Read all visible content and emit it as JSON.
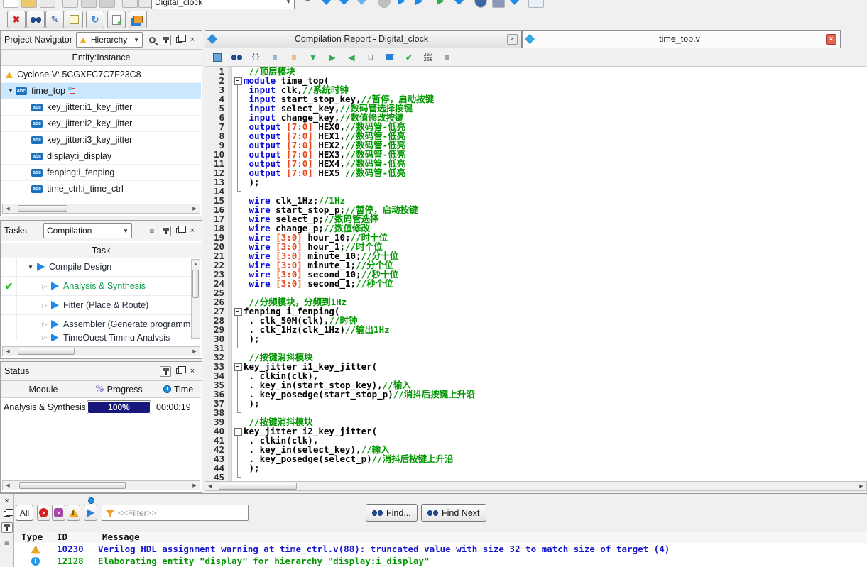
{
  "icons": {
    "close": "×",
    "menu": "≡",
    "down": "▼",
    "up": "▲",
    "left": "◀",
    "right": "▶",
    "expander_open": "▼",
    "expander_closed": "▷",
    "check": "✔",
    "refresh": "↻",
    "pencil": "✎",
    "cross": "✖",
    "abc_badge": "abc",
    "percent": "%",
    "error_glyph": "×",
    "info_glyph": "i",
    "brace": "{ }"
  },
  "colors": {
    "keyword": "#0b0bd8",
    "comment": "#009700",
    "number": "#e8481c",
    "selection": "#cbe8ff",
    "progress_bar": "#17177c",
    "warning_message": "#1515cc",
    "info_message": "#009700"
  },
  "titlebar": {
    "project_combo": "Digital_clock"
  },
  "project_navigator": {
    "title": "Project Navigator",
    "mode_combo": "Hierarchy",
    "column_header": "Entity:Instance",
    "tree": [
      {
        "label": "Cyclone V: 5CGXFC7C7F23C8",
        "icon": "device",
        "level": 0,
        "selected": false
      },
      {
        "label": "time_top",
        "icon": "abc",
        "level": 1,
        "selected": true,
        "badge": true
      },
      {
        "label": "key_jitter:i1_key_jitter",
        "icon": "abc",
        "level": 2,
        "selected": false
      },
      {
        "label": "key_jitter:i2_key_jitter",
        "icon": "abc",
        "level": 2,
        "selected": false
      },
      {
        "label": "key_jitter:i3_key_jitter",
        "icon": "abc",
        "level": 2,
        "selected": false
      },
      {
        "label": "display:i_display",
        "icon": "abc",
        "level": 2,
        "selected": false
      },
      {
        "label": "fenping:i_fenping",
        "icon": "abc",
        "level": 2,
        "selected": false
      },
      {
        "label": "time_ctrl:i_time_ctrl",
        "icon": "abc",
        "level": 2,
        "selected": false
      }
    ]
  },
  "tasks": {
    "title": "Tasks",
    "mode_combo": "Compilation",
    "column_header": "Task",
    "rows": [
      {
        "label": "Compile Design",
        "level": 0,
        "expander": "open",
        "check": false,
        "green": false,
        "clipped": false
      },
      {
        "label": "Analysis & Synthesis",
        "level": 1,
        "expander": "closed",
        "check": true,
        "green": true,
        "clipped": false
      },
      {
        "label": "Fitter (Place & Route)",
        "level": 1,
        "expander": "closed",
        "check": false,
        "green": false,
        "clipped": false
      },
      {
        "label": "Assembler (Generate programm",
        "level": 1,
        "expander": "closed",
        "check": false,
        "green": false,
        "clipped": false
      },
      {
        "label": "TimeQuest Timing Analysis",
        "level": 1,
        "expander": "closed",
        "check": false,
        "green": false,
        "clipped": true
      }
    ]
  },
  "status": {
    "title": "Status",
    "columns": {
      "module": "Module",
      "progress": "Progress",
      "time": "Time"
    },
    "rows": [
      {
        "module": "Analysis & Synthesis",
        "progress_pct": 100,
        "progress_label": "100%",
        "time": "00:00:19"
      }
    ]
  },
  "editor": {
    "tabs": [
      {
        "label": "Compilation Report - Digital_clock",
        "active": false
      },
      {
        "label": "time_top.v",
        "active": true
      }
    ],
    "line_indicator": [
      "267",
      "268"
    ],
    "code": [
      {
        "n": 1,
        "f": "",
        "s": [
          [
            "t",
            " "
          ],
          [
            "c",
            "//顶层模块"
          ]
        ]
      },
      {
        "n": 2,
        "f": "s",
        "s": [
          [
            "k",
            "module"
          ],
          [
            "t",
            " time_top("
          ]
        ]
      },
      {
        "n": 3,
        "f": "m",
        "s": [
          [
            "t",
            " "
          ],
          [
            "k",
            "input"
          ],
          [
            "t",
            " clk,"
          ],
          [
            "c",
            "//系统时钟"
          ]
        ]
      },
      {
        "n": 4,
        "f": "m",
        "s": [
          [
            "t",
            " "
          ],
          [
            "k",
            "input"
          ],
          [
            "t",
            " start_stop_key,"
          ],
          [
            "c",
            "//暂停，启动按键"
          ]
        ]
      },
      {
        "n": 5,
        "f": "m",
        "s": [
          [
            "t",
            " "
          ],
          [
            "k",
            "input"
          ],
          [
            "t",
            " select_key,"
          ],
          [
            "c",
            "//数码管选择按键"
          ]
        ]
      },
      {
        "n": 6,
        "f": "m",
        "s": [
          [
            "t",
            " "
          ],
          [
            "k",
            "input"
          ],
          [
            "t",
            " change_key,"
          ],
          [
            "c",
            "//数值修改按键"
          ]
        ]
      },
      {
        "n": 7,
        "f": "m",
        "s": [
          [
            "t",
            " "
          ],
          [
            "k",
            "output"
          ],
          [
            "t",
            " "
          ],
          [
            "n",
            "[7:0]"
          ],
          [
            "t",
            " HEX0,"
          ],
          [
            "c",
            "//数码管-低亮"
          ]
        ]
      },
      {
        "n": 8,
        "f": "m",
        "s": [
          [
            "t",
            " "
          ],
          [
            "k",
            "output"
          ],
          [
            "t",
            " "
          ],
          [
            "n",
            "[7:0]"
          ],
          [
            "t",
            " HEX1,"
          ],
          [
            "c",
            "//数码管-低亮"
          ]
        ]
      },
      {
        "n": 9,
        "f": "m",
        "s": [
          [
            "t",
            " "
          ],
          [
            "k",
            "output"
          ],
          [
            "t",
            " "
          ],
          [
            "n",
            "[7:0]"
          ],
          [
            "t",
            " HEX2,"
          ],
          [
            "c",
            "//数码管-低亮"
          ]
        ]
      },
      {
        "n": 10,
        "f": "m",
        "s": [
          [
            "t",
            " "
          ],
          [
            "k",
            "output"
          ],
          [
            "t",
            " "
          ],
          [
            "n",
            "[7:0]"
          ],
          [
            "t",
            " HEX3,"
          ],
          [
            "c",
            "//数码管-低亮"
          ]
        ]
      },
      {
        "n": 11,
        "f": "m",
        "s": [
          [
            "t",
            " "
          ],
          [
            "k",
            "output"
          ],
          [
            "t",
            " "
          ],
          [
            "n",
            "[7:0]"
          ],
          [
            "t",
            " HEX4,"
          ],
          [
            "c",
            "//数码管-低亮"
          ]
        ]
      },
      {
        "n": 12,
        "f": "m",
        "s": [
          [
            "t",
            " "
          ],
          [
            "k",
            "output"
          ],
          [
            "t",
            " "
          ],
          [
            "n",
            "[7:0]"
          ],
          [
            "t",
            " HEX5 "
          ],
          [
            "c",
            "//数码管-低亮"
          ]
        ]
      },
      {
        "n": 13,
        "f": "m",
        "s": [
          [
            "t",
            " );"
          ]
        ]
      },
      {
        "n": 14,
        "f": "e",
        "s": []
      },
      {
        "n": 15,
        "f": "",
        "s": [
          [
            "t",
            " "
          ],
          [
            "k",
            "wire"
          ],
          [
            "t",
            " clk_1Hz;"
          ],
          [
            "c",
            "//1Hz"
          ]
        ]
      },
      {
        "n": 16,
        "f": "",
        "s": [
          [
            "t",
            " "
          ],
          [
            "k",
            "wire"
          ],
          [
            "t",
            " start_stop_p;"
          ],
          [
            "c",
            "//暂停，启动按键"
          ]
        ]
      },
      {
        "n": 17,
        "f": "",
        "s": [
          [
            "t",
            " "
          ],
          [
            "k",
            "wire"
          ],
          [
            "t",
            " select_p;"
          ],
          [
            "c",
            "//数码管选择"
          ]
        ]
      },
      {
        "n": 18,
        "f": "",
        "s": [
          [
            "t",
            " "
          ],
          [
            "k",
            "wire"
          ],
          [
            "t",
            " change_p;"
          ],
          [
            "c",
            "//数值修改"
          ]
        ]
      },
      {
        "n": 19,
        "f": "",
        "s": [
          [
            "t",
            " "
          ],
          [
            "k",
            "wire"
          ],
          [
            "t",
            " "
          ],
          [
            "n",
            "[3:0]"
          ],
          [
            "t",
            " hour_10;"
          ],
          [
            "c",
            "//时十位"
          ]
        ]
      },
      {
        "n": 20,
        "f": "",
        "s": [
          [
            "t",
            " "
          ],
          [
            "k",
            "wire"
          ],
          [
            "t",
            " "
          ],
          [
            "n",
            "[3:0]"
          ],
          [
            "t",
            " hour_1;"
          ],
          [
            "c",
            "//时个位"
          ]
        ]
      },
      {
        "n": 21,
        "f": "",
        "s": [
          [
            "t",
            " "
          ],
          [
            "k",
            "wire"
          ],
          [
            "t",
            " "
          ],
          [
            "n",
            "[3:0]"
          ],
          [
            "t",
            " minute_10;"
          ],
          [
            "c",
            "//分十位"
          ]
        ]
      },
      {
        "n": 22,
        "f": "",
        "s": [
          [
            "t",
            " "
          ],
          [
            "k",
            "wire"
          ],
          [
            "t",
            " "
          ],
          [
            "n",
            "[3:0]"
          ],
          [
            "t",
            " minute_1;"
          ],
          [
            "c",
            "//分个位"
          ]
        ]
      },
      {
        "n": 23,
        "f": "",
        "s": [
          [
            "t",
            " "
          ],
          [
            "k",
            "wire"
          ],
          [
            "t",
            " "
          ],
          [
            "n",
            "[3:0]"
          ],
          [
            "t",
            " second_10;"
          ],
          [
            "c",
            "//秒十位"
          ]
        ]
      },
      {
        "n": 24,
        "f": "",
        "s": [
          [
            "t",
            " "
          ],
          [
            "k",
            "wire"
          ],
          [
            "t",
            " "
          ],
          [
            "n",
            "[3:0]"
          ],
          [
            "t",
            " second_1;"
          ],
          [
            "c",
            "//秒个位"
          ]
        ]
      },
      {
        "n": 25,
        "f": "",
        "s": []
      },
      {
        "n": 26,
        "f": "",
        "s": [
          [
            "t",
            " "
          ],
          [
            "c",
            "//分频模块，分频到1Hz"
          ]
        ]
      },
      {
        "n": 27,
        "f": "s",
        "s": [
          [
            "t",
            "fenping i_fenping("
          ]
        ]
      },
      {
        "n": 28,
        "f": "m",
        "s": [
          [
            "t",
            " . clk_50M(clk),"
          ],
          [
            "c",
            "//时钟"
          ]
        ]
      },
      {
        "n": 29,
        "f": "m",
        "s": [
          [
            "t",
            " . clk_1Hz(clk_1Hz)"
          ],
          [
            "c",
            "//输出1Hz"
          ]
        ]
      },
      {
        "n": 30,
        "f": "m",
        "s": [
          [
            "t",
            " );"
          ]
        ]
      },
      {
        "n": 31,
        "f": "e",
        "s": []
      },
      {
        "n": 32,
        "f": "",
        "s": [
          [
            "t",
            " "
          ],
          [
            "c",
            "//按键消抖模块"
          ]
        ]
      },
      {
        "n": 33,
        "f": "s",
        "s": [
          [
            "t",
            "key_jitter i1_key_jitter("
          ]
        ]
      },
      {
        "n": 34,
        "f": "m",
        "s": [
          [
            "t",
            " . clkin(clk),"
          ]
        ]
      },
      {
        "n": 35,
        "f": "m",
        "s": [
          [
            "t",
            " . key_in(start_stop_key),"
          ],
          [
            "c",
            "//输入"
          ]
        ]
      },
      {
        "n": 36,
        "f": "m",
        "s": [
          [
            "t",
            " . key_posedge(start_stop_p)"
          ],
          [
            "c",
            "//消抖后按键上升沿"
          ]
        ]
      },
      {
        "n": 37,
        "f": "m",
        "s": [
          [
            "t",
            " );"
          ]
        ]
      },
      {
        "n": 38,
        "f": "e",
        "s": []
      },
      {
        "n": 39,
        "f": "",
        "s": [
          [
            "t",
            " "
          ],
          [
            "c",
            "//按键消抖模块"
          ]
        ]
      },
      {
        "n": 40,
        "f": "s",
        "s": [
          [
            "t",
            "key_jitter i2_key_jitter("
          ]
        ]
      },
      {
        "n": 41,
        "f": "m",
        "s": [
          [
            "t",
            " . clkin(clk),"
          ]
        ]
      },
      {
        "n": 42,
        "f": "m",
        "s": [
          [
            "t",
            " . key_in(select_key),"
          ],
          [
            "c",
            "//输入"
          ]
        ]
      },
      {
        "n": 43,
        "f": "m",
        "s": [
          [
            "t",
            " . key_posedge(select_p)"
          ],
          [
            "c",
            "//消抖后按键上升沿"
          ]
        ]
      },
      {
        "n": 44,
        "f": "m",
        "s": [
          [
            "t",
            " );"
          ]
        ]
      },
      {
        "n": 45,
        "f": "e",
        "s": []
      }
    ]
  },
  "messages": {
    "all_button": "All",
    "filter_placeholder": "<<Filter>>",
    "find_button": "Find...",
    "find_next_button": "Find Next",
    "columns": [
      "Type",
      "ID",
      "Message"
    ],
    "rows": [
      {
        "type": "warning",
        "id": "10230",
        "message": "Verilog HDL assignment warning at time_ctrl.v(88): truncated value with size 32 to match size of target (4)",
        "color": "#1515cc"
      },
      {
        "type": "info",
        "id": "12128",
        "message": "Elaborating entity \"display\" for hierarchy \"display:i_display\"",
        "color": "#009700"
      }
    ]
  }
}
